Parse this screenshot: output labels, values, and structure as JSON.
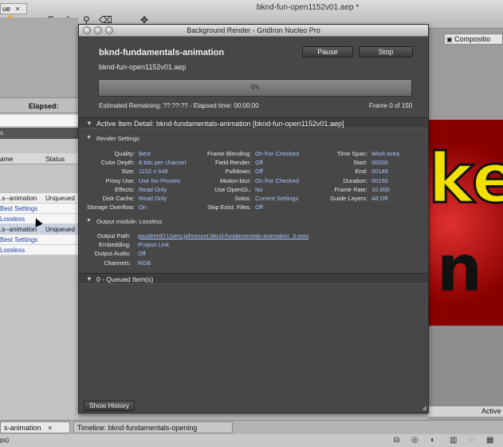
{
  "app": {
    "window_title": "bknd-fun-open1152v01.aep *"
  },
  "left_panel": {
    "project_tab": "ue",
    "elapsed_label": "Elapsed:",
    "section_letter": "s",
    "columns": [
      "ame",
      "Status"
    ],
    "rows": [
      {
        "name": ".s--animation",
        "status": "Unqueued",
        "kind": "item"
      },
      {
        "name": "Best Settings",
        "status": "",
        "kind": "sub"
      },
      {
        "name": "Lossless",
        "status": "",
        "kind": "sub"
      },
      {
        "name": ".s--animation",
        "status": "Unqueued",
        "kind": "sel"
      },
      {
        "name": "Best Settings",
        "status": "",
        "kind": "sub"
      },
      {
        "name": "Lossless",
        "status": "",
        "kind": "sub"
      }
    ]
  },
  "right_panel": {
    "comp_tab": "Compositio",
    "active_label": "Active",
    "viewer_letters": "ke n"
  },
  "bottom": {
    "tab1": "s-animation",
    "tab2": "Timeline: bknd-fundamentals-opening",
    "status_text": "ps)"
  },
  "dialog": {
    "title": "Background Render - GridIron Nucleo Pro",
    "project_name": "bknd-fundamentals-animation",
    "file_name": "bknd-fun-open1152v01.aep",
    "pause_label": "Pause",
    "stop_label": "Stop",
    "progress_text": "0%",
    "progress_fraction": 0,
    "est_remaining": "Estimated Remaining: ??:??:?? - Elapsed time: 00:00:00",
    "frame_count": "Frame 0 of 150",
    "active_item_header": "Active Item Detail: bknd-fundamentals-animation [bknd-fun-open1152v01.aep]",
    "render_settings_header": "Render Settings",
    "render_settings": {
      "col1": [
        {
          "label": "Quality:",
          "value": "Best"
        },
        {
          "label": "Color Depth:",
          "value": "8 bits per channel"
        },
        {
          "label": "Size:",
          "value": "1152 x 648"
        },
        {
          "label": "Proxy Use:",
          "value": "Use No Proxies"
        },
        {
          "label": "Effects:",
          "value": "Read Only"
        },
        {
          "label": "Disk Cache:",
          "value": "Read Only"
        },
        {
          "label": "Storage Overflow:",
          "value": "On"
        }
      ],
      "col2": [
        {
          "label": "Frame Blending:",
          "value": "On For Checked"
        },
        {
          "label": "Field Render:",
          "value": "Off"
        },
        {
          "label": "Pulldown:",
          "value": "Off"
        },
        {
          "label": "Motion blur:",
          "value": "On For Checked"
        },
        {
          "label": "Use OpenGL:",
          "value": "No"
        },
        {
          "label": "Solos:",
          "value": "Current Settings"
        },
        {
          "label": "Skip Exist. Files:",
          "value": "Off"
        }
      ],
      "col3": [
        {
          "label": "Time Span:",
          "value": "Work Area"
        },
        {
          "label": "Start:",
          "value": "00000"
        },
        {
          "label": "End:",
          "value": "00149"
        },
        {
          "label": "Duration:",
          "value": "00150"
        },
        {
          "label": "Frame Rate:",
          "value": "10.000"
        },
        {
          "label": "Guide Layers:",
          "value": "All Off"
        }
      ]
    },
    "output_module_header": "Output module: Lossless",
    "output_module": [
      {
        "label": "Output Path:",
        "value": "poudreHD:Users:johnmont:bknd-fundamentals-animation_3.mov"
      },
      {
        "label": "Embedding:",
        "value": "Project Link"
      },
      {
        "label": "Output Audio:",
        "value": "Off"
      },
      {
        "label": "Channels:",
        "value": "RGB"
      }
    ],
    "queued_header": "0 - Queued Item(s)",
    "show_history_label": "Show History"
  },
  "icons": {
    "triangle": "▼",
    "close": "×"
  }
}
